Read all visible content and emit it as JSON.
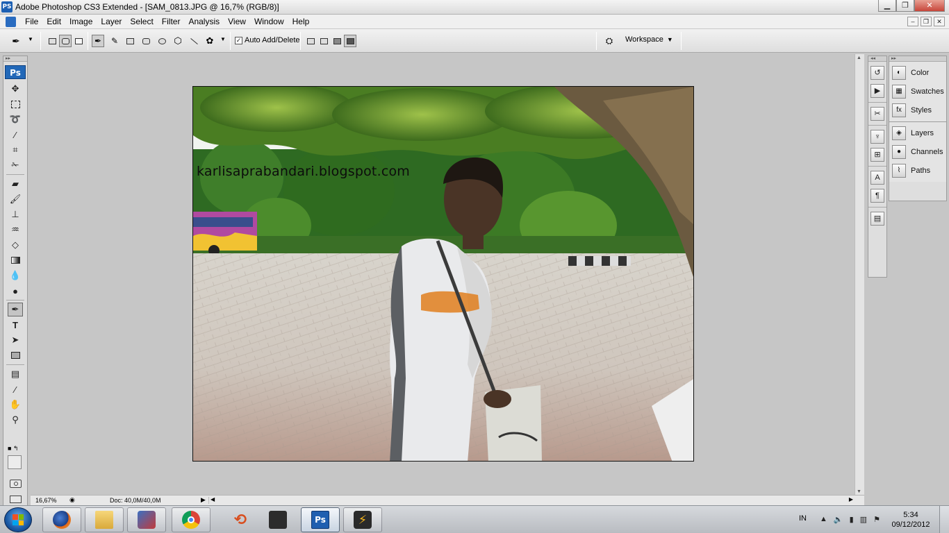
{
  "window": {
    "app_icon": "PS",
    "title": "Adobe Photoshop CS3 Extended - [SAM_0813.JPG @ 16,7% (RGB/8)]",
    "min_icon": "minimize-icon",
    "max_icon": "maximize-icon",
    "close_icon": "close-icon"
  },
  "menu": {
    "items": [
      "File",
      "Edit",
      "Image",
      "Layer",
      "Select",
      "Filter",
      "Analysis",
      "View",
      "Window",
      "Help"
    ]
  },
  "options": {
    "auto_add_label": "Auto Add/Delete",
    "auto_add_checked": true,
    "workspace_label": "Workspace"
  },
  "toolbox": {
    "logo": "Ps",
    "tools": [
      "move-tool",
      "marquee-tool",
      "lasso-tool",
      "magic-wand-tool",
      "crop-tool",
      "slice-tool",
      "healing-brush-tool",
      "brush-tool",
      "clone-stamp-tool",
      "history-brush-tool",
      "eraser-tool",
      "gradient-tool",
      "blur-tool",
      "dodge-tool",
      "pen-tool",
      "type-tool",
      "path-selection-tool",
      "rectangle-tool",
      "notes-tool",
      "eyedropper-tool",
      "hand-tool",
      "zoom-tool"
    ],
    "selected_tool": "pen-tool"
  },
  "document": {
    "watermark": "karlisaprabandari.blogspot.com",
    "zoom": "16,67%",
    "doc_info": "Doc: 40,0M/40,0M"
  },
  "panels": {
    "group1": [
      "Color",
      "Swatches",
      "Styles"
    ],
    "group2": [
      "Layers",
      "Channels",
      "Paths"
    ]
  },
  "taskbar": {
    "apps": [
      "firefox",
      "windows-explorer",
      "paint-editor",
      "google-chrome",
      "media-app",
      "camera-app",
      "photoshop",
      "winamp"
    ],
    "active_app": "photoshop",
    "ps_label": "Ps",
    "lang": "IN",
    "time": "5:34",
    "date": "09/12/2012"
  },
  "colors": {
    "ps_blue": "#2268b8",
    "workspace_bg": "#c6c6c6",
    "taskbar_bg": "#c8cbd0"
  }
}
